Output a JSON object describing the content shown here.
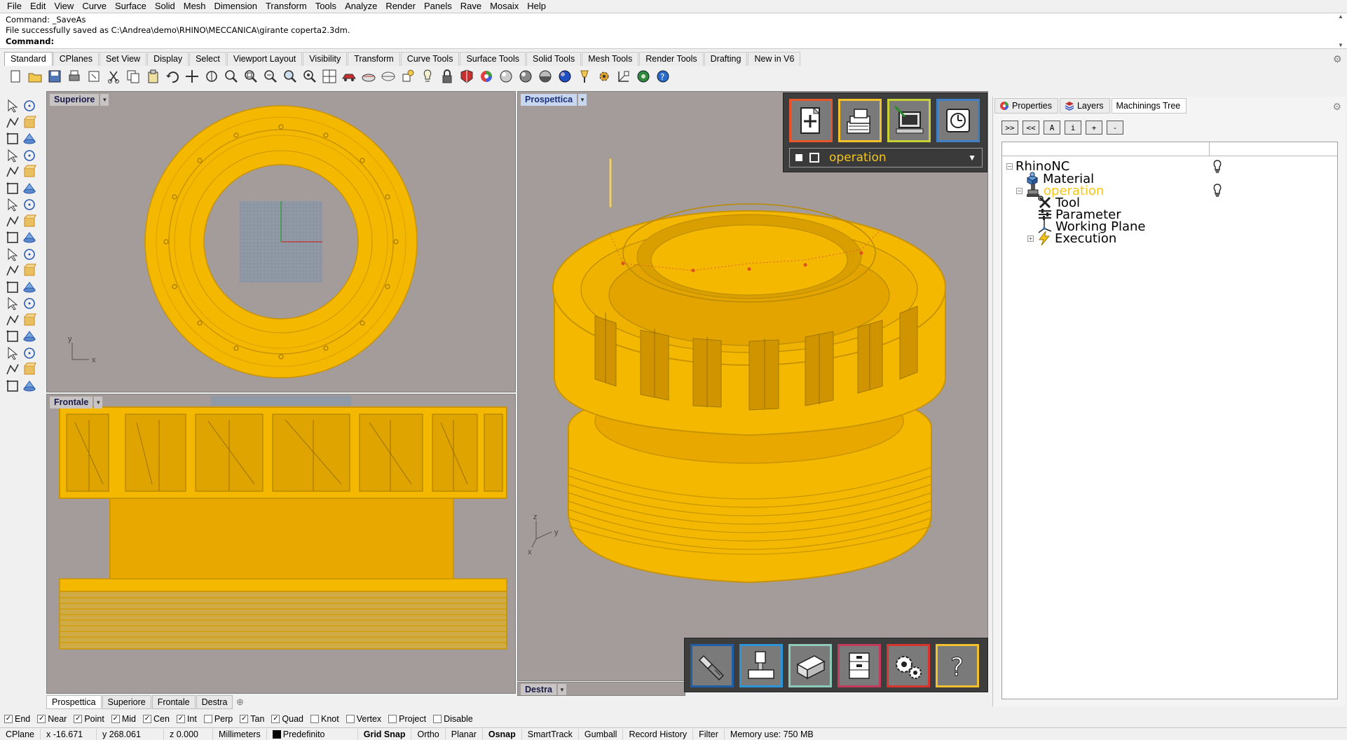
{
  "menu": [
    "File",
    "Edit",
    "View",
    "Curve",
    "Surface",
    "Solid",
    "Mesh",
    "Dimension",
    "Transform",
    "Tools",
    "Analyze",
    "Render",
    "Panels",
    "Rave",
    "Mosaix",
    "Help"
  ],
  "command": {
    "history": [
      "Command: _SaveAs",
      "File successfully saved as C:\\Andrea\\demo\\RHINO\\MECCANICA\\girante coperta2.3dm."
    ],
    "prompt": "Command:",
    "value": ""
  },
  "toolbar_tabs": [
    "Standard",
    "CPlanes",
    "Set View",
    "Display",
    "Select",
    "Viewport Layout",
    "Visibility",
    "Transform",
    "Curve Tools",
    "Surface Tools",
    "Solid Tools",
    "Mesh Tools",
    "Render Tools",
    "Drafting",
    "New in V6"
  ],
  "toolbar_tab_active": "Standard",
  "toolbar_icons": [
    "new-icon",
    "open-icon",
    "save-icon",
    "print-icon",
    "import-icon",
    "cut-icon",
    "copy-icon",
    "paste-icon",
    "undo-icon",
    "pan-icon",
    "rotate-view-icon",
    "zoom-icon",
    "zoom-window-icon",
    "zoom-extents-icon",
    "zoom-selected-icon",
    "zoom-all-icon",
    "four-viewports-icon",
    "car-icon",
    "render-preview-icon",
    "cplane-icon",
    "osnap-icon",
    "light-icon",
    "lock-icon",
    "material-icon",
    "color-wheel-icon",
    "shade-icon",
    "rendered-icon",
    "ghosted-icon",
    "sphere-icon",
    "lamp-icon",
    "options-icon",
    "gumball-icon",
    "rhino-nc-icon",
    "help-icon"
  ],
  "viewports": {
    "top": {
      "title": "Superiore",
      "axis_x": "x",
      "axis_y": "y"
    },
    "front": {
      "title": "Frontale"
    },
    "perspective": {
      "title": "Prospettica",
      "axis_x": "x",
      "axis_y": "y",
      "axis_z": "z"
    },
    "right": {
      "title": "Destra"
    }
  },
  "viewport_tabs": [
    "Prospettica",
    "Superiore",
    "Frontale",
    "Destra"
  ],
  "viewport_tab_active": "Prospettica",
  "nc_panel": {
    "operation_label": "operation",
    "top_buttons": [
      {
        "name": "new-operation-icon",
        "color": "#e5562a"
      },
      {
        "name": "machining-library-icon",
        "color": "#f2c12e"
      },
      {
        "name": "post-processor-icon",
        "color": "#c8d038"
      },
      {
        "name": "timer-icon",
        "color": "#3f7fc6"
      }
    ],
    "bottom_buttons": [
      {
        "name": "tool-icon",
        "color": "#1f5fa8"
      },
      {
        "name": "machine-icon",
        "color": "#2c95d8"
      },
      {
        "name": "stock-icon",
        "color": "#8ec9b9"
      },
      {
        "name": "archive-icon",
        "color": "#c43a5a"
      },
      {
        "name": "settings-icon",
        "color": "#d6342f"
      },
      {
        "name": "help-icon",
        "color": "#f2c12e"
      }
    ]
  },
  "right_panel": {
    "tabs": [
      "Properties",
      "Layers",
      "Machinings Tree"
    ],
    "active_tab": "Machinings Tree",
    "tree_tools": [
      ">>",
      "<<",
      "A",
      "i",
      "+",
      "-"
    ],
    "tree": {
      "root": "RhinoNC",
      "material": "Material",
      "operation": "operation",
      "tool": "Tool",
      "parameter": "Parameter",
      "working_plane": "Working Plane",
      "execution": "Execution"
    }
  },
  "osnap": [
    {
      "label": "End",
      "checked": true
    },
    {
      "label": "Near",
      "checked": true
    },
    {
      "label": "Point",
      "checked": true
    },
    {
      "label": "Mid",
      "checked": true
    },
    {
      "label": "Cen",
      "checked": true
    },
    {
      "label": "Int",
      "checked": true
    },
    {
      "label": "Perp",
      "checked": false
    },
    {
      "label": "Tan",
      "checked": true
    },
    {
      "label": "Quad",
      "checked": true
    },
    {
      "label": "Knot",
      "checked": false
    },
    {
      "label": "Vertex",
      "checked": false
    },
    {
      "label": "Project",
      "checked": false
    },
    {
      "label": "Disable",
      "checked": false
    }
  ],
  "status": {
    "cplane": "CPlane",
    "x": "x -16.671",
    "y": "y 268.061",
    "z": "z 0.000",
    "units": "Millimeters",
    "layer": "Predefinito",
    "grid_snap": "Grid Snap",
    "ortho": "Ortho",
    "planar": "Planar",
    "osnap": "Osnap",
    "smarttrack": "SmartTrack",
    "gumball": "Gumball",
    "record_history": "Record History",
    "filter": "Filter",
    "memory": "Memory use: 750 MB"
  },
  "colors": {
    "part_yellow": "#f5b800",
    "viewport_bg": "#a49b9b",
    "operation_text": "#f5c518"
  }
}
